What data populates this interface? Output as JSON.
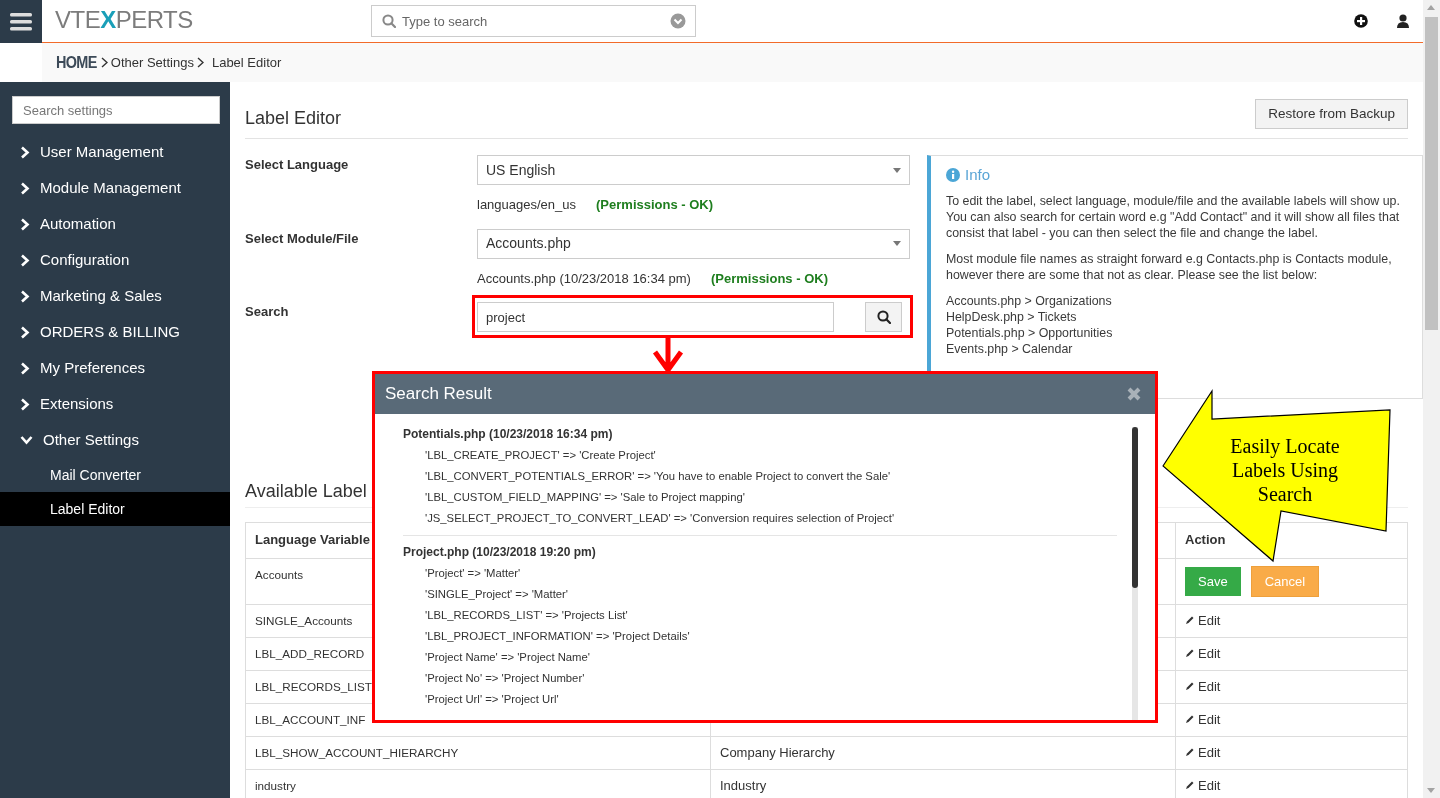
{
  "header": {
    "logo": {
      "start": "VTE",
      "mark": "X",
      "end": "PERTS"
    },
    "search": {
      "placeholder": "Type to search"
    }
  },
  "breadcrumb": [
    {
      "label": "HOME",
      "kind": "home"
    },
    {
      "label": "Other Settings",
      "kind": "link"
    },
    {
      "label": "Label Editor",
      "kind": "current"
    }
  ],
  "sidebar": {
    "search": {
      "placeholder": "Search settings"
    },
    "items": [
      {
        "label": "User Management",
        "expanded": false
      },
      {
        "label": "Module Management",
        "expanded": false
      },
      {
        "label": "Automation",
        "expanded": false
      },
      {
        "label": "Configuration",
        "expanded": false
      },
      {
        "label": "Marketing & Sales",
        "expanded": false
      },
      {
        "label": "ORDERS & BILLING",
        "expanded": false
      },
      {
        "label": "My Preferences",
        "expanded": false
      },
      {
        "label": "Extensions",
        "expanded": false
      },
      {
        "label": "Other Settings",
        "expanded": true,
        "children": [
          {
            "label": "Mail Converter",
            "selected": false
          },
          {
            "label": "Label Editor",
            "selected": true
          }
        ]
      }
    ]
  },
  "page": {
    "title": "Label Editor",
    "restore_button": "Restore from Backup"
  },
  "form": {
    "fields": [
      {
        "label": "Select Language",
        "kind": "select",
        "value": "US English",
        "path": "languages/en_us",
        "status": "(Permissions - OK)"
      },
      {
        "label": "Select Module/File",
        "kind": "select",
        "value": "Accounts.php",
        "path": "Accounts.php (10/23/2018 16:34 pm)",
        "status": "(Permissions - OK)"
      },
      {
        "label": "Search",
        "kind": "search",
        "value": "project"
      }
    ]
  },
  "info": {
    "title": "Info",
    "paragraphs": [
      "To edit the label, select language, module/file and the available labels will show up. You can also search for certain word e.g \"Add Contact\" and it will show all files that consist that label - you can then select the file and change the label.",
      "Most module file names as straight forward e.g Contacts.php is Contacts module, however there are some that not as clear. Please see the list below:"
    ],
    "mappings": [
      "Accounts.php > Organizations",
      "HelpDesk.php > Tickets",
      "Potentials.php > Opportunities",
      "Events.php > Calendar"
    ]
  },
  "labels": {
    "title": "Available Label",
    "columns": {
      "column_1": "Language Variable",
      "action": "Action"
    },
    "rows": [
      {
        "variable": "Accounts",
        "kind": "editing",
        "save": "Save",
        "cancel": "Cancel"
      },
      {
        "variable": "SINGLE_Accounts",
        "kind": "view",
        "edit": "Edit"
      },
      {
        "variable": "LBL_ADD_RECORD",
        "kind": "view",
        "edit": "Edit"
      },
      {
        "variable": "LBL_RECORDS_LIST",
        "kind": "view",
        "edit": "Edit"
      },
      {
        "variable": "LBL_ACCOUNT_INF",
        "kind": "view",
        "edit": "Edit"
      },
      {
        "variable": "LBL_SHOW_ACCOUNT_HIERARCHY",
        "value": "Company Hierarchy",
        "kind": "view",
        "edit": "Edit"
      },
      {
        "variable": "industry",
        "value": "Industry",
        "kind": "view",
        "edit": "Edit"
      }
    ]
  },
  "search_result": {
    "title": "Search Result",
    "groups": [
      {
        "file": "Potentials.php (10/23/2018 16:34 pm)",
        "entries": [
          "'LBL_CREATE_PROJECT' => 'Create Project'",
          "'LBL_CONVERT_POTENTIALS_ERROR' => 'You have to enable Project to convert the Sale'",
          "'LBL_CUSTOM_FIELD_MAPPING' => 'Sale to Project mapping'",
          "'JS_SELECT_PROJECT_TO_CONVERT_LEAD' => 'Conversion requires selection of Project'"
        ]
      },
      {
        "file": "Project.php (10/23/2018 19:20 pm)",
        "entries": [
          "'Project' => 'Matter'",
          "'SINGLE_Project' => 'Matter'",
          "'LBL_RECORDS_LIST' => 'Projects List'",
          "'LBL_PROJECT_INFORMATION' => 'Project Details'",
          "'Project Name' => 'Project Name'",
          "'Project No' => 'Project Number'",
          "'Project Url' => 'Project Url'"
        ]
      }
    ]
  },
  "callout": {
    "text": "Easily Locate Labels Using Search"
  }
}
